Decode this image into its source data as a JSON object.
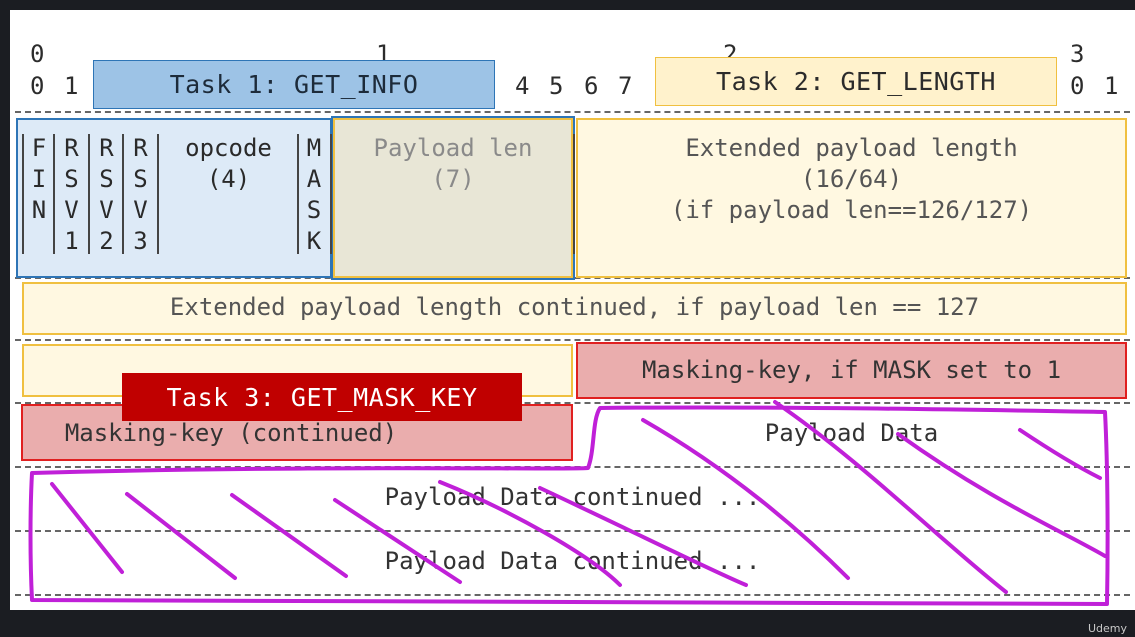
{
  "bit_ruler": {
    "tens": [
      "0",
      "1",
      "2",
      "3"
    ],
    "ones_left": [
      "0",
      "1"
    ],
    "ones_mid": [
      "4",
      "5",
      "6",
      "7"
    ],
    "ones_right": [
      "0",
      "1"
    ]
  },
  "tasks": {
    "task1": "Task 1: GET_INFO",
    "task2": "Task 2: GET_LENGTH",
    "task3": "Task 3: GET_MASK_KEY"
  },
  "fields": {
    "fin": [
      "F",
      "I",
      "N",
      ""
    ],
    "rsv1": [
      "R",
      "S",
      "V",
      "1"
    ],
    "rsv2": [
      "R",
      "S",
      "V",
      "2"
    ],
    "rsv3": [
      "R",
      "S",
      "V",
      "3"
    ],
    "opcode": [
      "opcode",
      "(4)"
    ],
    "mask": [
      "M",
      "A",
      "S",
      "K"
    ],
    "payload_len": [
      "Payload len",
      "(7)"
    ],
    "ext_len": [
      "Extended payload length",
      "(16/64)",
      "(if payload len==126/127)"
    ],
    "ext_len_cont": "Extended payload length continued, if payload len == 127",
    "masking_key": "Masking-key, if MASK set to 1",
    "masking_key_cont": "Masking-key (continued)",
    "payload_data": "Payload Data",
    "payload_cont_1": "Payload Data continued ...",
    "payload_cont_2": "Payload Data continued ..."
  },
  "colors": {
    "task1_fill": "#9dc3e6",
    "task1_border": "#2e75b6",
    "task2_fill": "#fff2cc",
    "task2_border": "#f0c040",
    "task3_fill": "#c00000",
    "mask_fill": "#eaadad",
    "mask_border": "#e02020",
    "annotation": "#c020d8"
  },
  "watermark": "Udemy"
}
